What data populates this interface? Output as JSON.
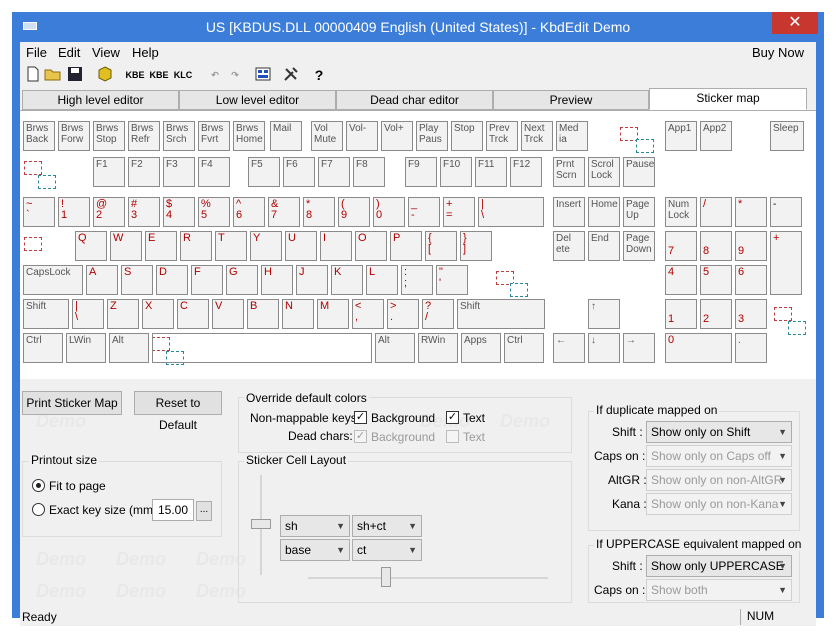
{
  "window": {
    "title": "US [KBDUS.DLL 00000409 English (United States)] - KbdEdit Demo",
    "close": "✕"
  },
  "menu": {
    "file": "File",
    "edit": "Edit",
    "view": "View",
    "help": "Help",
    "buy": "Buy Now"
  },
  "toolbar": {
    "kbe1": "KBE",
    "kbe2": "KBE",
    "klc": "KLC"
  },
  "tabs": [
    "High level editor",
    "Low level editor",
    "Dead char editor",
    "Preview",
    "Sticker map"
  ],
  "keys": {
    "row0": [
      "Brws\nBack",
      "Brws\nForw",
      "Brws\nStop",
      "Brws\nRefr",
      "Brws\nSrch",
      "Brws\nFvrt",
      "Brws\nHome",
      "Mail",
      "Vol\nMute",
      "Vol-",
      "Vol+",
      "Play\nPaus",
      "Stop",
      "Prev\nTrck",
      "Next\nTrck",
      "Med\nia",
      "App1",
      "App2",
      "Sleep"
    ],
    "frow": [
      "F1",
      "F2",
      "F3",
      "F4",
      "F5",
      "F6",
      "F7",
      "F8",
      "F9",
      "F10",
      "F11",
      "F12",
      "Prnt\nScrn",
      "Scrol\nLock",
      "Pause"
    ],
    "num": [
      "~\n`",
      "!\n1",
      "@\n2",
      "#\n3",
      "$\n4",
      "%\n5",
      "^\n6",
      "&\n7",
      "*\n8",
      "(\n9",
      ")\n0",
      "_\n-",
      "+\n="
    ],
    "nav1": [
      "Insert",
      "Home",
      "Page\nUp",
      "Num\nLock",
      "/",
      "*",
      "-"
    ],
    "q": [
      "Q",
      "W",
      "E",
      "R",
      "T",
      "Y",
      "U",
      "I",
      "O",
      "P",
      "{\n[",
      "}\n]"
    ],
    "nav2": [
      "Del\nete",
      "End",
      "Page\nDown",
      "7",
      "8",
      "9",
      "+"
    ],
    "a": [
      "CapsLock",
      "A",
      "S",
      "D",
      "F",
      "G",
      "H",
      "J",
      "K",
      "L",
      ":\n;",
      "\"\n'"
    ],
    "nav3": [
      "4",
      "5",
      "6"
    ],
    "z": [
      "Shift",
      "|\n\\",
      "Z",
      "X",
      "C",
      "V",
      "B",
      "N",
      "M",
      "<\n,",
      ">\n.",
      "?\n/",
      "Shift"
    ],
    "nav4": [
      "↑",
      "1",
      "2",
      "3"
    ],
    "bottom": [
      "Ctrl",
      "LWin",
      "Alt",
      "Alt",
      "RWin",
      "Apps",
      "Ctrl",
      "←",
      "↓",
      "→",
      "0",
      "."
    ],
    "pipe": "|\n\\"
  },
  "buttons": {
    "print": "Print Sticker Map",
    "reset": "Reset to Default",
    "ellipsis": "..."
  },
  "override": {
    "title": "Override default colors",
    "nonmap": "Non-mappable keys:",
    "dead": "Dead chars:",
    "background": "Background",
    "text": "Text"
  },
  "printout": {
    "title": "Printout size",
    "fit": "Fit to page",
    "exact": "Exact key size (mm)",
    "size": "15.00"
  },
  "layout": {
    "title": "Sticker Cell Layout",
    "sh": "sh",
    "shct": "sh+ct",
    "base": "base",
    "ct": "ct"
  },
  "duplicate": {
    "title": "If duplicate mapped on",
    "shift_lbl": "Shift :",
    "shift_val": "Show only on Shift",
    "caps_lbl": "Caps on :",
    "caps_val": "Show only on Caps off",
    "altgr_lbl": "AltGR :",
    "altgr_val": "Show only on non-AltGR",
    "kana_lbl": "Kana :",
    "kana_val": "Show only on non-Kana"
  },
  "upper": {
    "title": "If UPPERCASE equivalent mapped on",
    "shift_lbl": "Shift :",
    "shift_val": "Show only UPPERCASE",
    "caps_lbl": "Caps on :",
    "caps_val": "Show both"
  },
  "status": {
    "ready": "Ready",
    "num": "NUM"
  },
  "watermark": "Demo"
}
